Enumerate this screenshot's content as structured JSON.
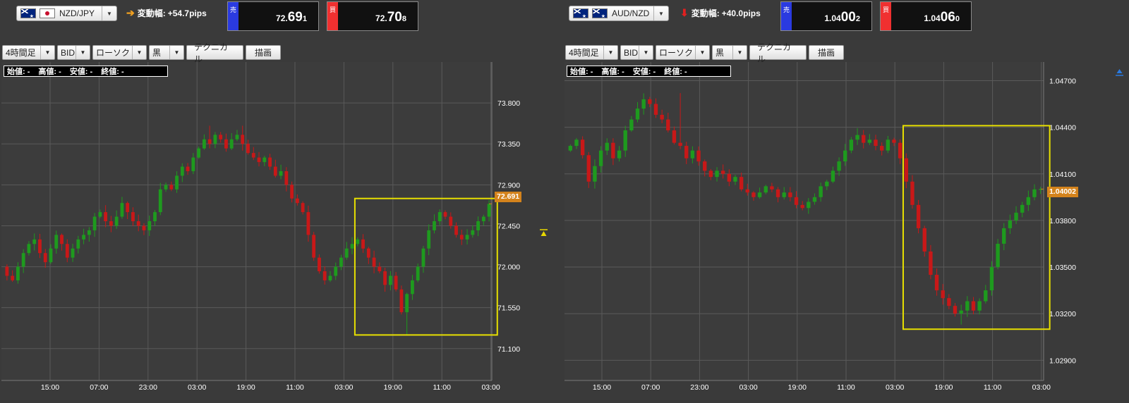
{
  "left": {
    "pair": "NZD/JPY",
    "flags": [
      "nz-flag-icon",
      "jp-flag-icon"
    ],
    "change_label": "変動幅:",
    "change_value": "+54.7pips",
    "change_direction": "up",
    "sell": {
      "label": "売",
      "price_prefix": "72.",
      "price_big": "69",
      "price_last": "1"
    },
    "buy": {
      "label": "買",
      "price_prefix": "72.",
      "price_big": "70",
      "price_last": "8"
    },
    "current_price": "72.691",
    "y_ticks": [
      "73.800",
      "73.350",
      "72.900",
      "72.450",
      "72.000",
      "71.550",
      "71.100"
    ],
    "y_range": [
      70.75,
      74.25
    ],
    "x_ticks": [
      "15:00",
      "07:00",
      "23:00",
      "03:00",
      "19:00",
      "11:00",
      "03:00",
      "19:00",
      "11:00",
      "03:00"
    ]
  },
  "right": {
    "pair": "AUD/NZD",
    "flags": [
      "au-flag-icon",
      "nz-flag-icon"
    ],
    "change_label": "変動幅:",
    "change_value": "+40.0pips",
    "change_direction": "down",
    "sell": {
      "label": "売",
      "price_prefix": "1.04",
      "price_big": "00",
      "price_last": "2"
    },
    "buy": {
      "label": "買",
      "price_prefix": "1.04",
      "price_big": "06",
      "price_last": "0"
    },
    "current_price": "1.04002",
    "y_ticks": [
      "1.04700",
      "1.04400",
      "1.04100",
      "1.03800",
      "1.03500",
      "1.03200",
      "1.02900"
    ],
    "y_range": [
      1.0277,
      1.0482
    ],
    "x_ticks": [
      "15:00",
      "07:00",
      "23:00",
      "03:00",
      "19:00",
      "11:00",
      "03:00",
      "19:00",
      "11:00",
      "03:00"
    ]
  },
  "toolbar": {
    "timeframe": "4時間足",
    "price_type": "BID",
    "chart_type": "ローソク",
    "theme": "黒",
    "technical": "テクニカル",
    "draw": "描画"
  },
  "ohlc": {
    "open_label": "始値:",
    "open_value": "-",
    "high_label": "高値:",
    "high_value": "-",
    "low_label": "安値:",
    "low_value": "-",
    "close_label": "終値:",
    "close_value": "-"
  },
  "colors": {
    "background": "#3a3a3a",
    "grid": "#5a5a5a",
    "up_candle": "#1e9a1e",
    "down_candle": "#c81818",
    "highlight_box": "#e8e000",
    "price_tag": "#d4831c",
    "sell": "#2a3ae0",
    "buy": "#f03030",
    "arrow_up": "#f0a020",
    "arrow_down": "#e02020"
  },
  "chart_data": [
    {
      "type": "candlestick",
      "series_name": "NZD/JPY",
      "path": [
        72.0,
        71.9,
        71.85,
        72.0,
        72.15,
        72.25,
        72.3,
        72.15,
        72.05,
        72.2,
        72.35,
        72.25,
        72.1,
        72.2,
        72.3,
        72.35,
        72.4,
        72.55,
        72.6,
        72.5,
        72.45,
        72.55,
        72.7,
        72.6,
        72.5,
        72.45,
        72.4,
        72.5,
        72.6,
        72.85,
        72.9,
        72.85,
        73.0,
        73.1,
        73.05,
        73.2,
        73.3,
        73.4,
        73.35,
        73.45,
        73.4,
        73.3,
        73.4,
        73.45,
        73.35,
        73.25,
        73.2,
        73.15,
        73.2,
        73.1,
        73.0,
        73.05,
        72.9,
        72.75,
        72.7,
        72.6,
        72.35,
        72.1,
        71.95,
        71.85,
        71.9,
        72.0,
        72.1,
        72.2,
        72.25,
        72.3,
        72.2,
        72.1,
        72.0,
        71.95,
        71.8,
        71.9,
        71.75,
        71.5,
        71.7,
        71.85,
        72.0,
        72.2,
        72.4,
        72.5,
        72.6,
        72.55,
        72.45,
        72.35,
        72.3,
        72.35,
        72.4,
        72.5,
        72.55,
        72.691
      ],
      "hi_extremes": {
        "37": 73.55,
        "43": 73.55
      },
      "lo_extremes": {
        "73": 71.25
      },
      "highlight_box": {
        "x0": 64,
        "x1": 89,
        "y_top": 72.75,
        "y_bottom": 71.25
      }
    },
    {
      "type": "candlestick",
      "series_name": "AUD/NZD",
      "path": [
        1.0425,
        1.0428,
        1.0432,
        1.0422,
        1.0405,
        1.0415,
        1.0425,
        1.043,
        1.042,
        1.0425,
        1.0438,
        1.0445,
        1.0452,
        1.0458,
        1.0455,
        1.0448,
        1.0445,
        1.0438,
        1.043,
        1.0428,
        1.042,
        1.0425,
        1.0418,
        1.0412,
        1.0408,
        1.0412,
        1.041,
        1.0405,
        1.0408,
        1.04,
        1.0398,
        1.0395,
        1.0398,
        1.0402,
        1.04,
        1.0395,
        1.0398,
        1.0395,
        1.039,
        1.0388,
        1.0392,
        1.0395,
        1.0402,
        1.0405,
        1.0412,
        1.0418,
        1.0425,
        1.0432,
        1.0435,
        1.043,
        1.0432,
        1.0428,
        1.0425,
        1.0432,
        1.043,
        1.042,
        1.0405,
        1.039,
        1.0375,
        1.036,
        1.0345,
        1.0335,
        1.033,
        1.0325,
        1.032,
        1.0322,
        1.0328,
        1.0322,
        1.0328,
        1.0335,
        1.035,
        1.0365,
        1.0375,
        1.038,
        1.0385,
        1.039,
        1.0395,
        1.04,
        1.04002
      ],
      "hi_extremes": {
        "18": 1.0462
      },
      "lo_extremes": {
        "64": 1.0313
      },
      "highlight_box": {
        "x0": 55,
        "x1": 78,
        "y_top": 1.0441,
        "y_bottom": 1.031
      }
    }
  ]
}
